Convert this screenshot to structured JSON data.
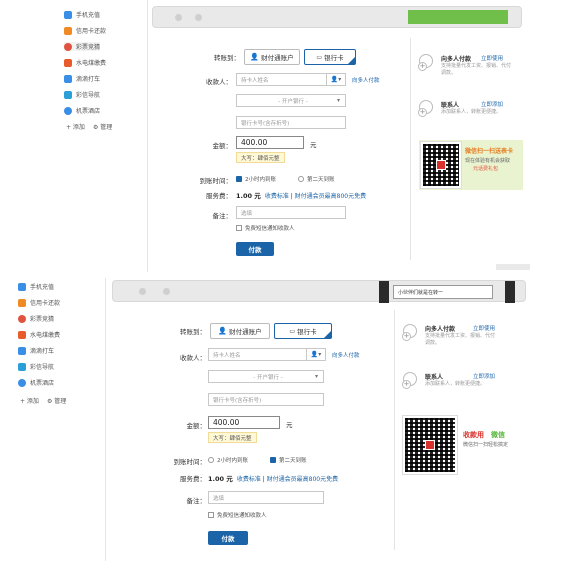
{
  "sidebar": {
    "items": [
      {
        "label": "手机充值",
        "icon": "mobile-icon",
        "color": "#3a8ee6"
      },
      {
        "label": "信用卡还款",
        "icon": "credit-card-icon",
        "color": "#f08a24"
      },
      {
        "label": "彩票竞猜",
        "icon": "lottery-icon",
        "color": "#e0533f"
      },
      {
        "label": "水电煤缴费",
        "icon": "utility-icon",
        "color": "#e85c2c"
      },
      {
        "label": "滴滴打车",
        "icon": "taxi-icon",
        "color": "#3a8ee6"
      },
      {
        "label": "彩信导航",
        "icon": "navigation-icon",
        "color": "#2b9fd8"
      },
      {
        "label": "机票酒店",
        "icon": "plane-icon",
        "color": "#3a8ee6"
      }
    ],
    "add_label": "+ 添加",
    "manage_label": "管理"
  },
  "browser_bottom": {
    "address": "小伙伴们就是在转一"
  },
  "form": {
    "transfer_to_label": "转账到：",
    "tab_account": "财付通账户",
    "tab_bank": "银行卡",
    "payee_label": "收款人：",
    "payee_placeholder": "持卡人姓名",
    "batch_link": "向多人付款",
    "bank_select": "- 开户银行 -",
    "card_placeholder": "银行卡号(含存折号)",
    "amount_label": "金额：",
    "amount_value": "400.00",
    "amount_unit": "元",
    "amount_hint": "大写：肆佰元整",
    "arrival_label": "到账时间：",
    "arrival_opt1": "2小时内到账",
    "arrival_opt2": "第二天到账",
    "fee_label": "服务费：",
    "fee_value": "1.00 元",
    "fee_link1": "收费标准",
    "fee_sep": " | ",
    "fee_link2": "财付通会员最高800元免费",
    "note_label": "备注：",
    "note_placeholder": "选填",
    "free_sms": "免费短信通知收款人",
    "pay_button": "付款"
  },
  "right": {
    "multi_title": "向多人付款",
    "multi_link": "立即使用",
    "multi_desc": "支持批量代发工资、报销、代付调款。",
    "contact_title": "联系人",
    "contact_link": "立即添加",
    "contact_desc": "添加联系人，转账更便捷。",
    "ad_top_title": "微信扫一扫送表卡",
    "ad_top_sub": "现在体验有机会获取",
    "ad_top_sub2": "元话费礼包",
    "ad_bottom_title1": "收款用",
    "ad_bottom_title2": "微信",
    "ad_bottom_sub": "微信扫一扫轻松搞定",
    "colors": {
      "wechat_green": "#55b837",
      "brand_red": "#d9312b",
      "link_blue": "#1b64a8"
    }
  }
}
